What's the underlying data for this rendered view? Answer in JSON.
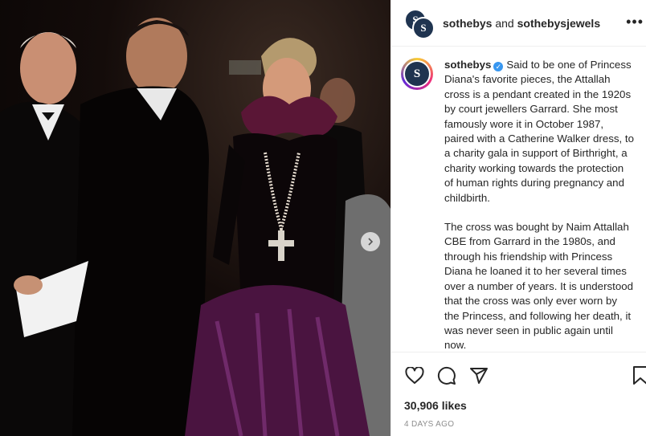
{
  "header": {
    "account_primary": "sothebys",
    "conjunction": "and",
    "account_secondary": "sothebysjewels",
    "avatar_letter_1": "S",
    "avatar_letter_2": "S",
    "avatar_icon": "sothebys-logo-icon",
    "more_icon": "more-options-icon"
  },
  "post": {
    "author": "sothebys",
    "verified_icon": "verified-badge-icon",
    "avatar_letter": "S",
    "caption_p1": "Said to be one of Princess Diana's favorite pieces, the Attallah cross is a pendant created in the 1920s by court jewellers Garrard. She most famously wore it in October 1987, paired with a Catherine Walker dress, to a charity gala in support of Birthright, a charity working towards the protection of human rights during pregnancy and childbirth.",
    "caption_p2": "The cross was bought by Naim Attallah CBE from Garrard in the 1980s, and through his friendship with Princess Diana he loaned it to her several times over a number of years. It is understood that the cross was only ever worn by the Princess, and following her death, it was never seen in public again until now."
  },
  "actions": {
    "like_icon": "heart-icon",
    "comment_icon": "comment-icon",
    "share_icon": "share-icon",
    "save_icon": "bookmark-icon"
  },
  "likes": "30,906 likes",
  "age": "4 DAYS AGO",
  "photo": {
    "next_icon": "chevron-right-icon"
  },
  "colors": {
    "brand_navy": "#1f3450",
    "verified_blue": "#3897f0",
    "meta_gray": "#8e8e8e"
  }
}
